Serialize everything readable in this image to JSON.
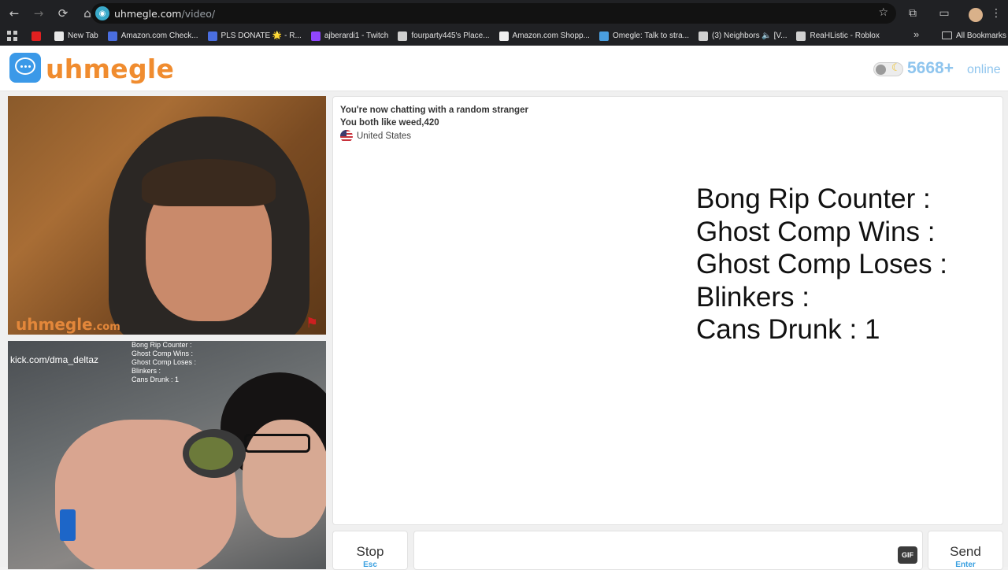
{
  "browser": {
    "url_host": "uhmegle.com",
    "url_path": "/video/",
    "bookmarks": [
      {
        "label": "",
        "color": "#e02020"
      },
      {
        "label": "New Tab",
        "color": "#e8e8e8"
      },
      {
        "label": "Amazon.com Check...",
        "color": "#4a6ee0"
      },
      {
        "label": "PLS DONATE 🌟 - R...",
        "color": "#4a6ee0"
      },
      {
        "label": "ajberardi1 - Twitch",
        "color": "#9146ff"
      },
      {
        "label": "fourparty445's Place...",
        "color": "#d0d0d0"
      },
      {
        "label": "Amazon.com Shopp...",
        "color": "#f0f0f0"
      },
      {
        "label": "Omegle: Talk to stra...",
        "color": "#4a9fe0"
      },
      {
        "label": "(3) Neighbors 🔈 [V...",
        "color": "#d0d0d0"
      },
      {
        "label": "ReaHListic - Roblox",
        "color": "#d0d0d0"
      }
    ],
    "more_label": "»",
    "all_bookmarks_label": "All Bookmarks"
  },
  "header": {
    "logo_text": "uhmegle",
    "online_count": "5668+",
    "online_label": "online"
  },
  "video_top": {
    "watermark": "uhmegle",
    "watermark_suffix": ".com"
  },
  "video_bottom": {
    "overlay_lines": [
      "Bong Rip Counter :",
      "Ghost Comp Wins :",
      "Ghost Comp Loses :",
      "Blinkers :",
      "Cans Drunk : 1"
    ],
    "channel_text": "kick.com/dma_deltaz"
  },
  "chat": {
    "system_line_1": "You're now chatting with a random stranger",
    "system_line_2": "You both like weed,420",
    "country": "United States",
    "counter_lines": [
      "Bong Rip Counter :",
      "Ghost Comp Wins :",
      "Ghost Comp Loses :",
      "Blinkers :",
      "Cans Drunk : 1"
    ]
  },
  "controls": {
    "stop_label": "Stop",
    "stop_key": "Esc",
    "send_label": "Send",
    "send_key": "Enter",
    "gif_label": "GIF",
    "message_value": ""
  }
}
